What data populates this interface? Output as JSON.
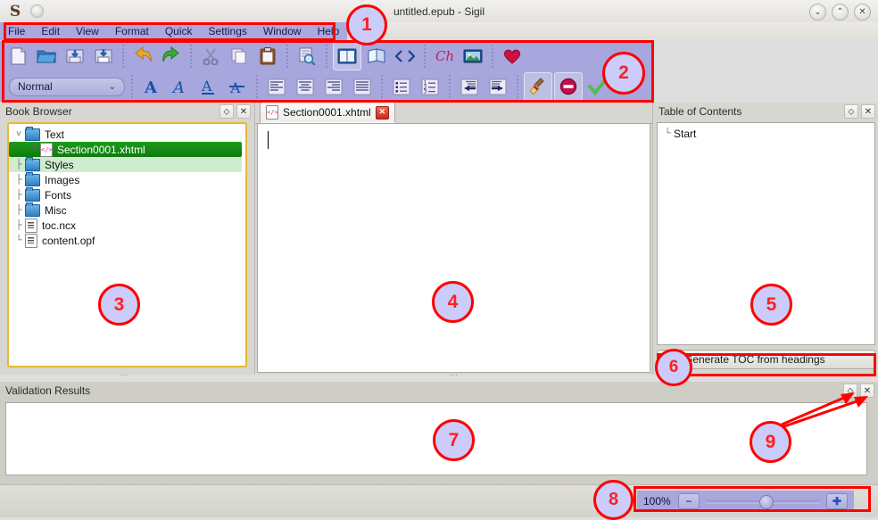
{
  "window": {
    "title": "untitled.epub - Sigil",
    "logo": "sigil-logo",
    "controls": [
      {
        "name": "minimize",
        "glyph": "⌄"
      },
      {
        "name": "maximize",
        "glyph": "⌃"
      },
      {
        "name": "close",
        "glyph": "✕"
      }
    ]
  },
  "menubar": {
    "items": [
      {
        "label": "File"
      },
      {
        "label": "Edit"
      },
      {
        "label": "View"
      },
      {
        "label": "Format"
      },
      {
        "label": "Quick"
      },
      {
        "label": "Settings"
      },
      {
        "label": "Window"
      },
      {
        "label": "Help"
      }
    ]
  },
  "toolbar": {
    "row1": [
      {
        "name": "new-file-button",
        "icon": "new-document-icon"
      },
      {
        "name": "open-button",
        "icon": "open-folder-icon"
      },
      {
        "name": "save-button",
        "icon": "save-disk-icon"
      },
      {
        "name": "save-as-button",
        "icon": "save-as-disk-icon"
      },
      {
        "name": "undo-button",
        "icon": "undo-arrow-icon"
      },
      {
        "name": "redo-button",
        "icon": "redo-arrow-icon"
      },
      {
        "name": "cut-button",
        "icon": "scissors-icon"
      },
      {
        "name": "copy-button",
        "icon": "copy-pages-icon"
      },
      {
        "name": "paste-button",
        "icon": "clipboard-icon"
      },
      {
        "name": "find-replace-button",
        "icon": "find-magnifier-icon"
      },
      {
        "name": "book-view-button",
        "icon": "open-book-icon"
      },
      {
        "name": "split-view-button",
        "icon": "split-book-icon"
      },
      {
        "name": "code-view-button",
        "icon": "angle-brackets-icon"
      },
      {
        "name": "insert-special-char-button",
        "icon": "special-character-icon"
      },
      {
        "name": "insert-image-button",
        "icon": "picture-icon"
      },
      {
        "name": "heart-button",
        "icon": "heart-icon"
      }
    ],
    "style_select": {
      "value": "Normal",
      "chevron": "⌄"
    },
    "row2": [
      {
        "name": "bold-button",
        "icon": "bold-a-icon"
      },
      {
        "name": "italic-button",
        "icon": "italic-a-icon"
      },
      {
        "name": "underline-button",
        "icon": "underline-a-icon"
      },
      {
        "name": "strikethrough-button",
        "icon": "strikethrough-a-icon"
      },
      {
        "name": "align-left-button",
        "icon": "align-left-icon"
      },
      {
        "name": "align-center-button",
        "icon": "align-center-icon"
      },
      {
        "name": "align-right-button",
        "icon": "align-right-icon"
      },
      {
        "name": "align-justify-button",
        "icon": "align-justify-icon"
      },
      {
        "name": "bullet-list-button",
        "icon": "bullet-list-icon"
      },
      {
        "name": "numbered-list-button",
        "icon": "numbered-list-icon"
      },
      {
        "name": "decrease-indent-button",
        "icon": "outdent-arrow-icon"
      },
      {
        "name": "increase-indent-button",
        "icon": "indent-arrow-icon"
      },
      {
        "name": "clean-button",
        "icon": "broom-icon"
      },
      {
        "name": "remove-formatting-button",
        "icon": "no-entry-icon"
      },
      {
        "name": "validate-button",
        "icon": "green-check-icon"
      }
    ]
  },
  "book_browser": {
    "title": "Book Browser",
    "float_glyph": "⬦",
    "close_glyph": "✕",
    "tree": [
      {
        "label": "Text",
        "icon": "folder-icon",
        "level": 0,
        "state": "normal",
        "expander": "v"
      },
      {
        "label": "Section0001.xhtml",
        "icon": "xhtml-file-icon",
        "level": 1,
        "state": "selected"
      },
      {
        "label": "Styles",
        "icon": "folder-icon",
        "level": 0,
        "state": "highlight"
      },
      {
        "label": "Images",
        "icon": "folder-icon",
        "level": 0,
        "state": "normal"
      },
      {
        "label": "Fonts",
        "icon": "folder-icon",
        "level": 0,
        "state": "normal"
      },
      {
        "label": "Misc",
        "icon": "folder-icon",
        "level": 0,
        "state": "normal"
      },
      {
        "label": "toc.ncx",
        "icon": "ncx-file-icon",
        "level": 0,
        "state": "normal"
      },
      {
        "label": "content.opf",
        "icon": "opf-file-icon",
        "level": 0,
        "state": "normal"
      }
    ]
  },
  "editor": {
    "tab": {
      "label": "Section0001.xhtml",
      "icon": "xhtml-file-icon",
      "close_glyph": "✕"
    },
    "content": ""
  },
  "toc": {
    "title": "Table of Contents",
    "float_glyph": "⬦",
    "close_glyph": "✕",
    "entries": [
      {
        "label": "Start"
      }
    ],
    "generate_button": "Generate TOC from headings"
  },
  "validation": {
    "title": "Validation Results",
    "float_glyph": "⬦",
    "close_glyph": "✕",
    "rows": []
  },
  "statusbar": {
    "zoom": {
      "level": "100%",
      "minus": "−",
      "plus": "✚"
    }
  },
  "annotations": {
    "circles": [
      {
        "n": "1",
        "target": "menubar"
      },
      {
        "n": "2",
        "target": "toolbar"
      },
      {
        "n": "3",
        "target": "book-browser"
      },
      {
        "n": "4",
        "target": "editor"
      },
      {
        "n": "5",
        "target": "table-of-contents"
      },
      {
        "n": "6",
        "target": "generate-toc-button"
      },
      {
        "n": "7",
        "target": "validation-results"
      },
      {
        "n": "8",
        "target": "zoom-control"
      },
      {
        "n": "9",
        "target": "panel-header-buttons"
      }
    ],
    "color": "#ff0000",
    "fill": "#ccccfa"
  }
}
